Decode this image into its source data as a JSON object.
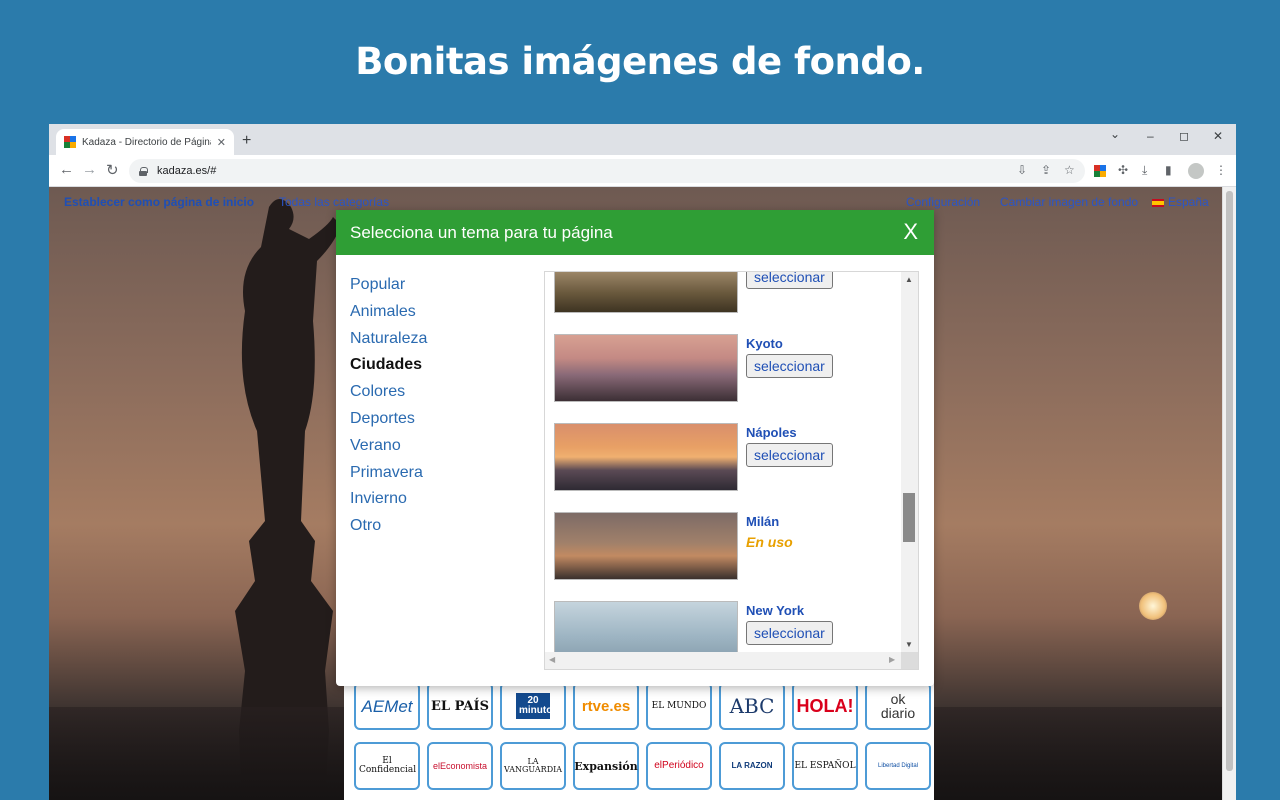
{
  "headline": "Bonitas imágenes de fondo.",
  "browser": {
    "tab_title": "Kadaza - Directorio de Páginas W",
    "tab_close": "✕",
    "new_tab": "+",
    "window_controls": {
      "dropdown": "⌄",
      "minimize": "–",
      "maximize": "◻",
      "close": "✕"
    },
    "nav": {
      "back": "←",
      "forward": "→",
      "reload": "↻"
    },
    "url": "kadaza.es/#",
    "colors": {
      "kadaza_red": "#d93025",
      "kadaza_blue": "#1a73e8",
      "kadaza_green": "#188038",
      "kadaza_yellow": "#f9ab00"
    }
  },
  "page": {
    "top_links": {
      "set_home": "Establecer como página de inicio",
      "all_categories": "Todas las categorías",
      "settings": "Configuración",
      "change_background": "Cambiar imagen de fondo",
      "country": "España"
    },
    "modal": {
      "title": "Selecciona un tema para tu página",
      "close": "X",
      "header_color": "#2f9e35",
      "categories": [
        {
          "label": "Popular",
          "active": false
        },
        {
          "label": "Animales",
          "active": false
        },
        {
          "label": "Naturaleza",
          "active": false
        },
        {
          "label": "Ciudades",
          "active": true
        },
        {
          "label": "Colores",
          "active": false
        },
        {
          "label": "Deportes",
          "active": false
        },
        {
          "label": "Verano",
          "active": false
        },
        {
          "label": "Primavera",
          "active": false
        },
        {
          "label": "Invierno",
          "active": false
        },
        {
          "label": "Otro",
          "active": false
        }
      ],
      "themes": [
        {
          "name": "",
          "button": "seleccionar",
          "in_use": false
        },
        {
          "name": "Kyoto",
          "button": "seleccionar",
          "in_use": false
        },
        {
          "name": "Nápoles",
          "button": "seleccionar",
          "in_use": false
        },
        {
          "name": "Milán",
          "status": "En uso",
          "in_use": true
        },
        {
          "name": "New York",
          "button": "seleccionar",
          "in_use": false
        }
      ],
      "in_use_color": "#e8a000"
    },
    "logos_row1": [
      "AEMet",
      "EL PAÍS",
      "20 minutos",
      "rtve.es",
      "EL MUNDO",
      "ABC",
      "HOLA!",
      "ok diario"
    ],
    "logos_row2": [
      "El Confidencial",
      "elEconomista",
      "LA VANGUARDIA",
      "Expansión",
      "elPeriódico",
      "LA RAZON",
      "EL ESPAÑOL",
      "Libertad Digital"
    ]
  }
}
